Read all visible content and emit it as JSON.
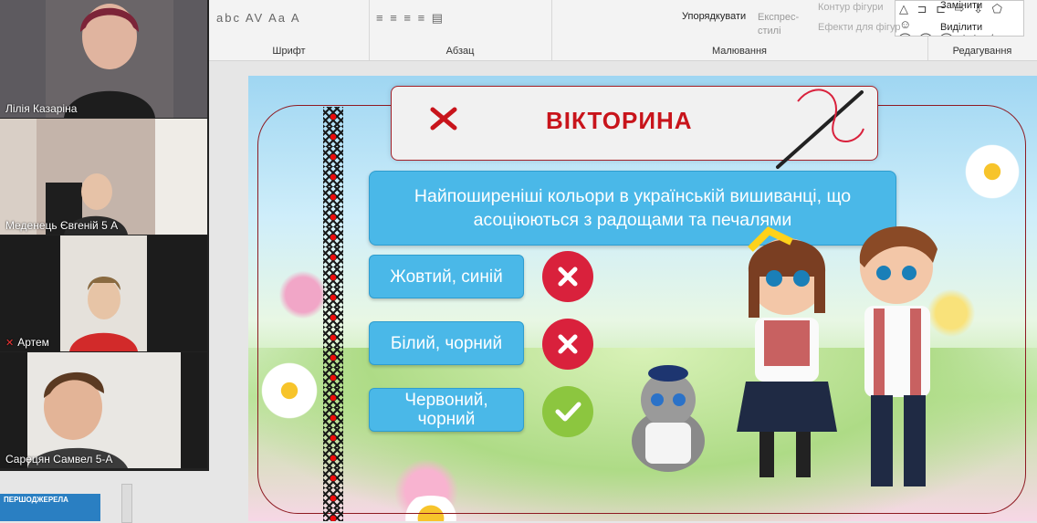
{
  "ribbon": {
    "groups": [
      {
        "name": "Шрифт"
      },
      {
        "name": "Абзац"
      },
      {
        "name": "Малювання"
      },
      {
        "name": "Редагування"
      }
    ],
    "font_icons": "abc AV Aa A",
    "para_icons": "≡ ≡ ≡ ≡ ▤",
    "arrange_label": "Упорядкувати",
    "quick_styles_label": "Експрес-\nстилі",
    "shape_outline_label": "Контур фігури",
    "shape_effects_label": "Ефекти для фігур",
    "replace_label": "Замінити",
    "select_label": "Виділити",
    "shapes_row1": "△ ⊐ ⊏ ⇨ ⇩ ⬠ ☺",
    "shapes_row2": "⌒ ⌒ ⌒ { } ☆"
  },
  "participants": [
    {
      "name": "Лілія Казаріна",
      "muted": false
    },
    {
      "name": "Меденець Євгеній 5 А",
      "muted": false,
      "active": true
    },
    {
      "name": "Артем",
      "muted": true
    },
    {
      "name": "Сарецян Самвел 5-А",
      "muted": false
    }
  ],
  "thumbnail_label": "ПЕРШОДЖЕРЕЛА",
  "slide": {
    "title": "ВІКТОРИНА",
    "question_line1": "Найпоширеніші кольори в українській вишиванці, що",
    "question_line2": "асоціюються з радощами та печалями",
    "answers": [
      {
        "text": "Жовтий, синій",
        "correct": false
      },
      {
        "text": "Білий, чорний",
        "correct": false
      },
      {
        "text": "Червоний,\nчорний",
        "correct": true
      }
    ]
  },
  "colors": {
    "accent_blue": "#4ab8e8",
    "title_red": "#c8141b",
    "wrong_red": "#d9213c",
    "right_green": "#8cc63f"
  }
}
